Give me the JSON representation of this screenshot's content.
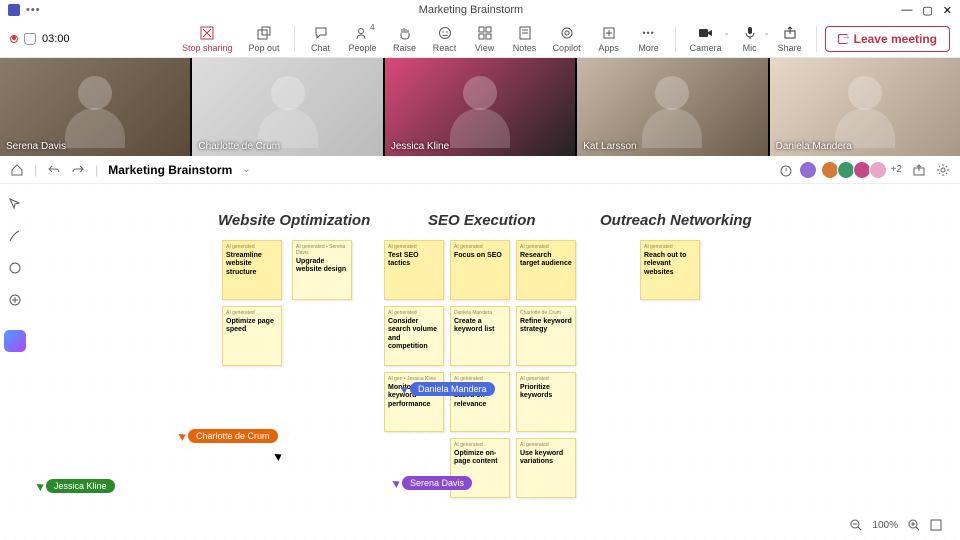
{
  "window": {
    "title": "Marketing Brainstorm",
    "minimize": "—",
    "maximize": "▢",
    "close": "✕"
  },
  "recording": {
    "time": "03:00"
  },
  "toolbar": {
    "stop_sharing": "Stop sharing",
    "pop_out": "Pop out",
    "chat": "Chat",
    "people": "People",
    "people_count": "4",
    "raise": "Raise",
    "react": "React",
    "view": "View",
    "notes": "Notes",
    "copilot": "Copilot",
    "apps": "Apps",
    "more": "More",
    "camera": "Camera",
    "mic": "Mic",
    "share": "Share",
    "leave": "Leave meeting"
  },
  "participants": [
    {
      "name": "Serena Davis"
    },
    {
      "name": "Charlotte de Crum"
    },
    {
      "name": "Jessica Kline"
    },
    {
      "name": "Kat Larsson"
    },
    {
      "name": "Daniela Mandera"
    }
  ],
  "whiteboard": {
    "title": "Marketing Brainstorm",
    "extra_avatars": "+2",
    "zoom": "100%"
  },
  "columns": {
    "c1": "Website Optimization",
    "c2": "SEO Execution",
    "c3": "Outreach Networking"
  },
  "notes": {
    "tag_ai": "AI generated",
    "tag_ai_serena": "AI generated • Serena Davis",
    "tag_daniela": "Daniela Mandera",
    "tag_charlotte": "Charlotte de Crum",
    "tag_jessica": "AI gen • Jessica Kline",
    "n1": "Streamline website structure",
    "n2": "Upgrade website design",
    "n3": "Optimize page speed",
    "n4": "Test SEO tactics",
    "n5": "Focus on SEO",
    "n6": "Research target audience",
    "n7": "Consider search volume and competition",
    "n8": "Create a keyword list",
    "n9": "Refine keyword strategy",
    "n10": "Monitor keyword performance",
    "n11": "keywords based on relevance",
    "n12": "Prioritize keywords",
    "n13": "Optimize on-page content",
    "n14": "Use keyword variations",
    "n15": "Reach out to relevant websites"
  },
  "cursors": {
    "charlotte": "Charlotte de Crum",
    "jessica": "Jessica Kline",
    "daniela": "Daniela Mandera",
    "serena": "Serena Davis"
  }
}
